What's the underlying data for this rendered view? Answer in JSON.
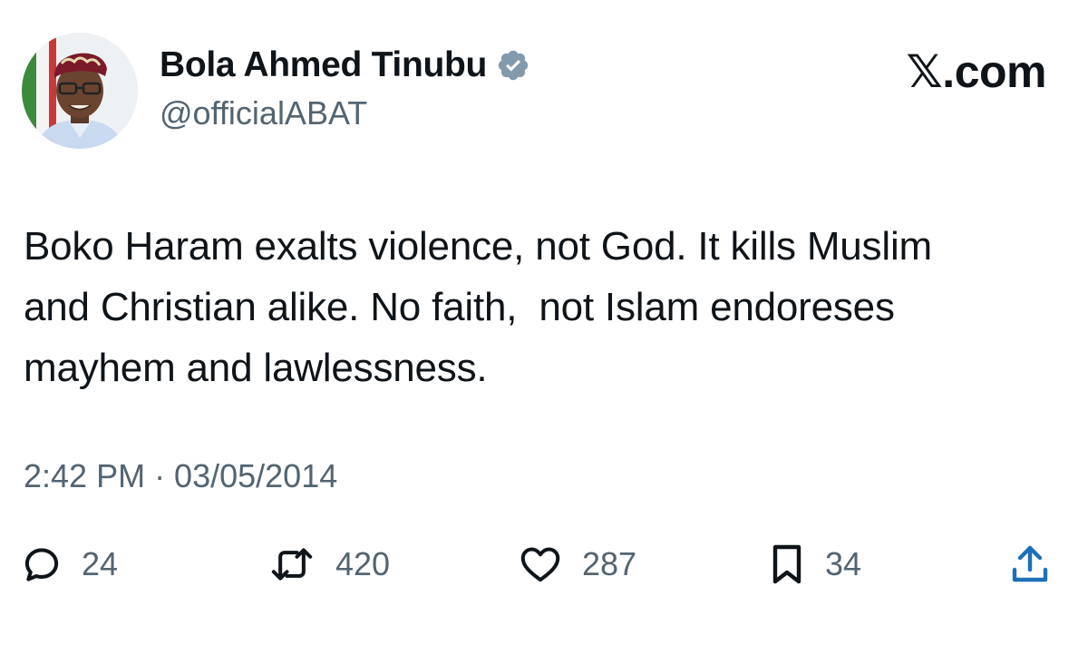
{
  "author": {
    "display_name": "Bola Ahmed Tinubu",
    "handle": "@officialABAT",
    "verified": true
  },
  "brand": "𝕏.com",
  "tweet": {
    "text": "Boko Haram exalts violence, not God. It kills Muslim\nand Christian alike. No faith,  not Islam endoreses\nmayhem and lawlessness.",
    "timestamp": "2:42 PM · 03/05/2014"
  },
  "stats": {
    "replies": "24",
    "retweets": "420",
    "likes": "287",
    "bookmarks": "34"
  },
  "icons": {
    "reply": "reply-icon",
    "retweet": "retweet-icon",
    "like": "heart-icon",
    "bookmark": "bookmark-icon",
    "share": "share-icon",
    "verified": "verified-badge-icon"
  },
  "colors": {
    "text": "#0f1419",
    "secondary": "#536471",
    "verified_badge": "#829aab"
  }
}
